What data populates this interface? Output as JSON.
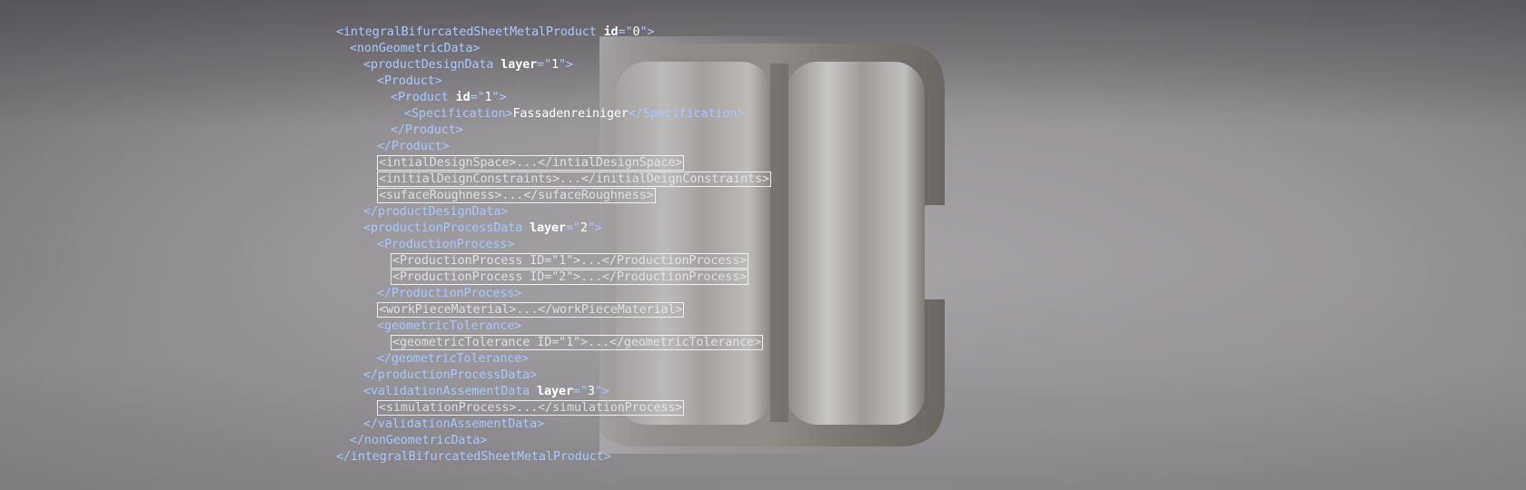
{
  "xml_lines": [
    {
      "indent": 0,
      "parts": [
        {
          "t": "tag",
          "v": "<integralBifurcatedSheetMetalProduct "
        },
        {
          "t": "attr",
          "v": "id"
        },
        {
          "t": "tag",
          "v": "=\""
        },
        {
          "t": "val",
          "v": "0"
        },
        {
          "t": "tag",
          "v": "\">"
        }
      ]
    },
    {
      "indent": 1,
      "parts": [
        {
          "t": "tag",
          "v": "<nonGeometricData>"
        }
      ]
    },
    {
      "indent": 2,
      "parts": [
        {
          "t": "tag",
          "v": "<productDesignData "
        },
        {
          "t": "attr",
          "v": "layer"
        },
        {
          "t": "tag",
          "v": "=\""
        },
        {
          "t": "val",
          "v": "1"
        },
        {
          "t": "tag",
          "v": "\">"
        }
      ]
    },
    {
      "indent": 3,
      "parts": [
        {
          "t": "tag",
          "v": "<Product>"
        }
      ]
    },
    {
      "indent": 4,
      "parts": [
        {
          "t": "tag",
          "v": "<Product "
        },
        {
          "t": "attr",
          "v": "id"
        },
        {
          "t": "tag",
          "v": "=\""
        },
        {
          "t": "val",
          "v": "1"
        },
        {
          "t": "tag",
          "v": "\">"
        }
      ]
    },
    {
      "indent": 5,
      "parts": [
        {
          "t": "tag",
          "v": "<Specification>"
        },
        {
          "t": "txt",
          "v": "Fassadenreiniger"
        },
        {
          "t": "tag",
          "v": "</Specification>"
        }
      ]
    },
    {
      "indent": 4,
      "parts": [
        {
          "t": "tag",
          "v": "</Product>"
        }
      ]
    },
    {
      "indent": 3,
      "parts": [
        {
          "t": "tag",
          "v": "</Product>"
        }
      ]
    },
    {
      "indent": 3,
      "boxed": true,
      "parts": [
        {
          "t": "box",
          "v": "<intialDesignSpace>...</intialDesignSpace>"
        }
      ]
    },
    {
      "indent": 3,
      "boxed": true,
      "parts": [
        {
          "t": "box",
          "v": "<initialDeignConstraints>...</initialDeignConstraints>"
        }
      ]
    },
    {
      "indent": 3,
      "boxed": true,
      "parts": [
        {
          "t": "box",
          "v": "<sufaceRoughness>...</sufaceRoughness>"
        }
      ]
    },
    {
      "indent": 2,
      "parts": [
        {
          "t": "tag",
          "v": "</productDesignData>"
        }
      ]
    },
    {
      "indent": 2,
      "parts": [
        {
          "t": "tag",
          "v": "<productionProcessData "
        },
        {
          "t": "attr",
          "v": "layer"
        },
        {
          "t": "tag",
          "v": "=\""
        },
        {
          "t": "val",
          "v": "2"
        },
        {
          "t": "tag",
          "v": "\">"
        }
      ]
    },
    {
      "indent": 3,
      "parts": [
        {
          "t": "tag",
          "v": "<ProductionProcess>"
        }
      ]
    },
    {
      "indent": 4,
      "boxed": true,
      "parts": [
        {
          "t": "box",
          "v": "<ProductionProcess ID=\"1\">...</ProductionProcess>"
        }
      ]
    },
    {
      "indent": 4,
      "boxed": true,
      "parts": [
        {
          "t": "box",
          "v": "<ProductionProcess ID=\"2\">...</ProductionProcess>"
        }
      ]
    },
    {
      "indent": 3,
      "parts": [
        {
          "t": "tag",
          "v": "</ProductionProcess>"
        }
      ]
    },
    {
      "indent": 3,
      "boxed": true,
      "parts": [
        {
          "t": "box",
          "v": "<workPieceMaterial>...</workPieceMaterial>"
        }
      ]
    },
    {
      "indent": 3,
      "parts": [
        {
          "t": "tag",
          "v": "<geometricTolerance>"
        }
      ]
    },
    {
      "indent": 4,
      "boxed": true,
      "parts": [
        {
          "t": "box",
          "v": "<geometricTolerance ID=\"1\">...</geometricTolerance>"
        }
      ]
    },
    {
      "indent": 3,
      "parts": [
        {
          "t": "tag",
          "v": "</geometricTolerance>"
        }
      ]
    },
    {
      "indent": 2,
      "parts": [
        {
          "t": "tag",
          "v": "</productionProcessData>"
        }
      ]
    },
    {
      "indent": 2,
      "parts": [
        {
          "t": "tag",
          "v": "<validationAssementData "
        },
        {
          "t": "attr",
          "v": "layer"
        },
        {
          "t": "tag",
          "v": "=\""
        },
        {
          "t": "val",
          "v": "3"
        },
        {
          "t": "tag",
          "v": "\">"
        }
      ]
    },
    {
      "indent": 3,
      "boxed": true,
      "parts": [
        {
          "t": "box",
          "v": "<simulationProcess>...</simulationProcess>"
        }
      ]
    },
    {
      "indent": 2,
      "parts": [
        {
          "t": "tag",
          "v": "</validationAssementData>"
        }
      ]
    },
    {
      "indent": 1,
      "parts": [
        {
          "t": "tag",
          "v": "</nonGeometricData>"
        }
      ]
    },
    {
      "indent": 0,
      "parts": [
        {
          "t": "tag",
          "v": "</integralBifurcatedSheetMetalProduct>"
        }
      ]
    }
  ],
  "colors": {
    "tag": "#a9c8ff",
    "attr_value": "#ffffff",
    "box_border": "#f5f5f5"
  },
  "image": {
    "subject": "bifurcated-sheet-metal-profile"
  }
}
